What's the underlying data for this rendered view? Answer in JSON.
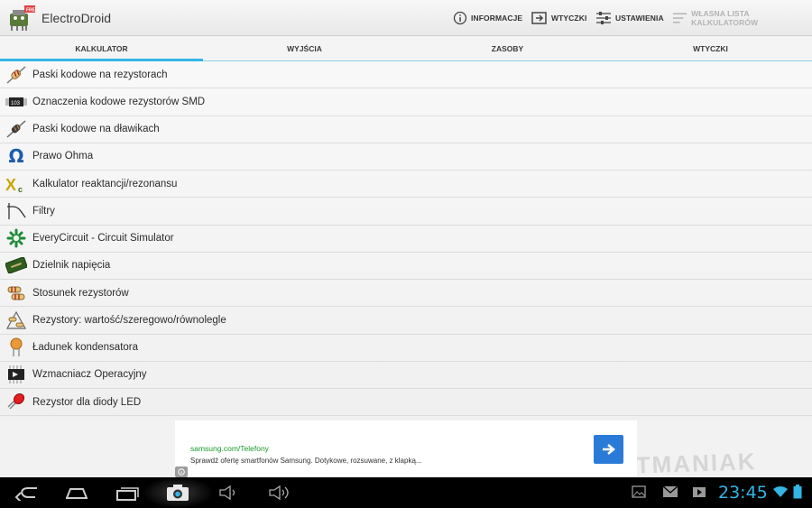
{
  "app": {
    "title": "ElectroDroid"
  },
  "actions": {
    "info": "INFORMACJE",
    "plugins": "WTYCZKI",
    "settings": "USTAWIENIA",
    "custom_list": "WŁASNA LISTA KALKULATORÓW"
  },
  "tabs": [
    "KALKULATOR",
    "WYJŚCIA",
    "ZASOBY",
    "WTYCZKI"
  ],
  "list": [
    {
      "label": "Paski kodowe na rezystorach",
      "icon": "resistor-icon"
    },
    {
      "label": "Oznaczenia kodowe rezystorów SMD",
      "icon": "smd-resistor-icon"
    },
    {
      "label": "Paski kodowe na dławikach",
      "icon": "inductor-icon"
    },
    {
      "label": "Prawo Ohma",
      "icon": "omega-icon"
    },
    {
      "label": "Kalkulator reaktancji/rezonansu",
      "icon": "reactance-icon"
    },
    {
      "label": "Filtry",
      "icon": "filter-icon"
    },
    {
      "label": "EveryCircuit - Circuit Simulator",
      "icon": "everycircuit-icon"
    },
    {
      "label": "Dzielnik napięcia",
      "icon": "voltage-divider-icon"
    },
    {
      "label": "Stosunek rezystorów",
      "icon": "resistor-ratio-icon"
    },
    {
      "label": "Rezystory: wartość/szeregowo/równolegle",
      "icon": "resistor-network-icon"
    },
    {
      "label": "Ładunek kondensatora",
      "icon": "capacitor-icon"
    },
    {
      "label": "Wzmacniacz Operacyjny",
      "icon": "opamp-icon"
    },
    {
      "label": "Rezystor dla diody LED",
      "icon": "led-icon"
    }
  ],
  "ad": {
    "url": "samsung.com/Telefony",
    "text": "Sprawdź ofertę smartfonów Samsung. Dotykowe, rozsuwane, z klapką..."
  },
  "watermark": "TABLETMANIAK",
  "status": {
    "time": "23:45"
  },
  "colors": {
    "accent": "#33b5e5",
    "ad_button": "#2a7bd8",
    "ad_url": "#1a9a2a"
  }
}
